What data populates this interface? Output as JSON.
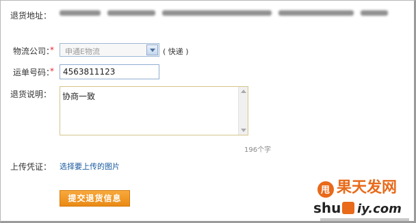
{
  "form": {
    "address_label": "退货地址：",
    "logistics_label": "物流公司：",
    "logistics_value": "申通E物流",
    "logistics_hint": "( 快递 )",
    "tracking_label": "运单号码：",
    "tracking_value": "4563811123",
    "note_label": "退货说明：",
    "note_value": "协商一致",
    "char_count": "196个字",
    "upload_label": "上传凭证：",
    "upload_link": "选择要上传的图片",
    "submit_label": "提交退货信息"
  },
  "watermark": {
    "site": "shu",
    "brand_top": "甩",
    "site_full": "shuiy.com",
    "colors": {
      "orange": "#e86a1a",
      "dark": "#222222"
    }
  }
}
